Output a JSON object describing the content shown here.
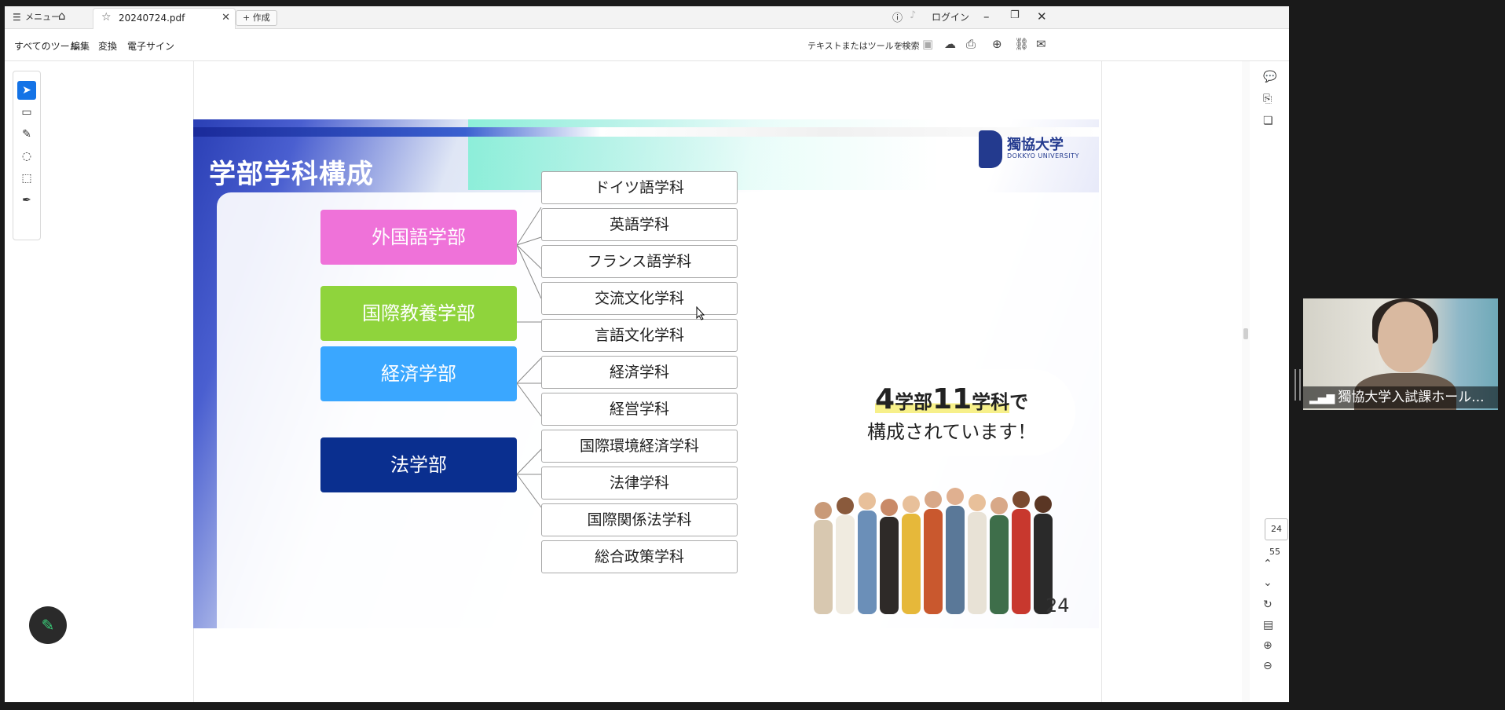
{
  "tabbar": {
    "menu_label": "メニュー",
    "tab_title": "20240724.pdf",
    "new_label": "作成",
    "login_label": "ログイン"
  },
  "toolbar": {
    "all_tools": "すべてのツール",
    "edit": "編集",
    "convert": "変換",
    "esign": "電子サイン",
    "search_label": "テキストまたはツールを検索"
  },
  "slide": {
    "title": "学部学科構成",
    "logo_name": "獨協大学",
    "logo_en": "DOKKYO UNIVERSITY",
    "faculties": [
      {
        "label": "外国語学部",
        "color": "#ef72d9"
      },
      {
        "label": "国際教養学部",
        "color": "#8fd43c"
      },
      {
        "label": "経済学部",
        "color": "#3aa7ff"
      },
      {
        "label": "法学部",
        "color": "#0a2f8f"
      }
    ],
    "departments": [
      "ドイツ語学科",
      "英語学科",
      "フランス語学科",
      "交流文化学科",
      "言語文化学科",
      "経済学科",
      "経営学科",
      "国際環境経済学科",
      "法律学科",
      "国際関係法学科",
      "総合政策学科"
    ],
    "callout": {
      "num1": "4",
      "word1": "学部",
      "num2": "11",
      "word2": "学科",
      "tail": "で",
      "line2": "構成されています！"
    },
    "page_number": "24"
  },
  "pager": {
    "current": "24",
    "total": "55"
  },
  "video": {
    "participant_name": "獨協大学入試課ホール..."
  }
}
